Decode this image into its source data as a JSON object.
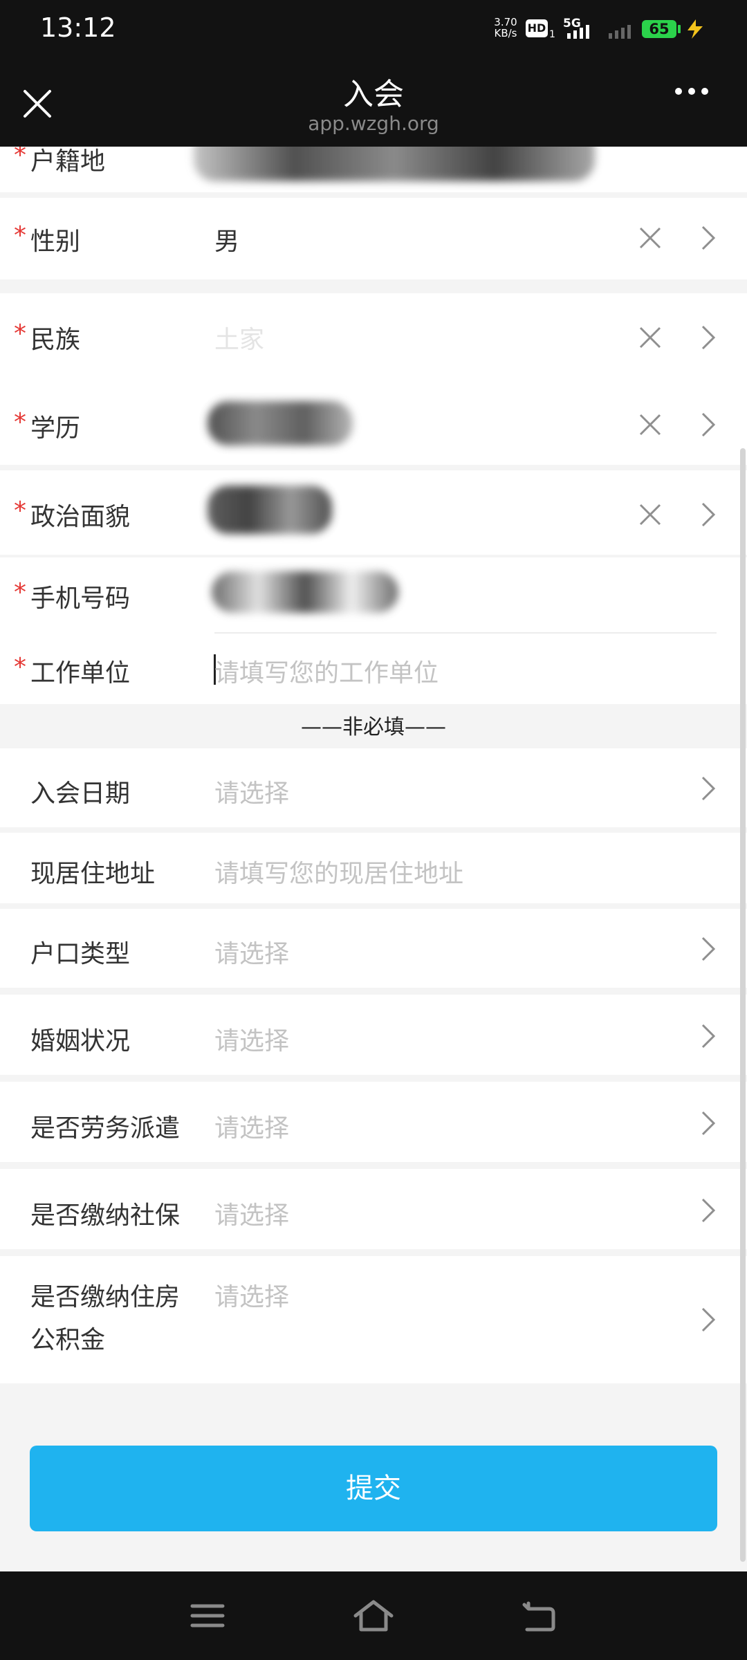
{
  "status_bar": {
    "time": "13:12",
    "net_speed_value": "3.70",
    "net_speed_unit": "KB/s",
    "hd_label": "HD",
    "hd_sub": "1",
    "network": "5G",
    "battery": "65"
  },
  "header": {
    "title": "入会",
    "subtitle": "app.wzgh.org"
  },
  "form": {
    "required": [
      {
        "label": "户籍地",
        "value": ""
      },
      {
        "label": "性别",
        "value": "男"
      },
      {
        "label": "民族",
        "value": "土家"
      },
      {
        "label": "学历",
        "value": ""
      },
      {
        "label": "政治面貌",
        "value": ""
      },
      {
        "label": "手机号码",
        "value": ""
      },
      {
        "label": "工作单位",
        "placeholder": "请填写您的工作单位"
      }
    ],
    "divider": "——非必填——",
    "optional": [
      {
        "label": "入会日期",
        "placeholder": "请选择"
      },
      {
        "label": "现居住地址",
        "placeholder": "请填写您的现居住地址"
      },
      {
        "label": "户口类型",
        "placeholder": "请选择"
      },
      {
        "label": "婚姻状况",
        "placeholder": "请选择"
      },
      {
        "label": "是否劳务派遣",
        "placeholder": "请选择"
      },
      {
        "label": "是否缴纳社保",
        "placeholder": "请选择"
      },
      {
        "label_line1": "是否缴纳住房",
        "label_line2": "公积金",
        "placeholder": "请选择"
      }
    ],
    "required_mark": "*"
  },
  "submit_label": "提交",
  "icons": {
    "close": "close-icon",
    "more": "more-dots-icon",
    "clear": "clear-x-icon",
    "chevron": "chevron-right-icon",
    "menu": "menu-icon",
    "home": "home-icon",
    "back": "back-icon"
  },
  "colors": {
    "accent": "#1fb3ef",
    "required_star": "#e53935",
    "placeholder": "#c3c3c3"
  }
}
